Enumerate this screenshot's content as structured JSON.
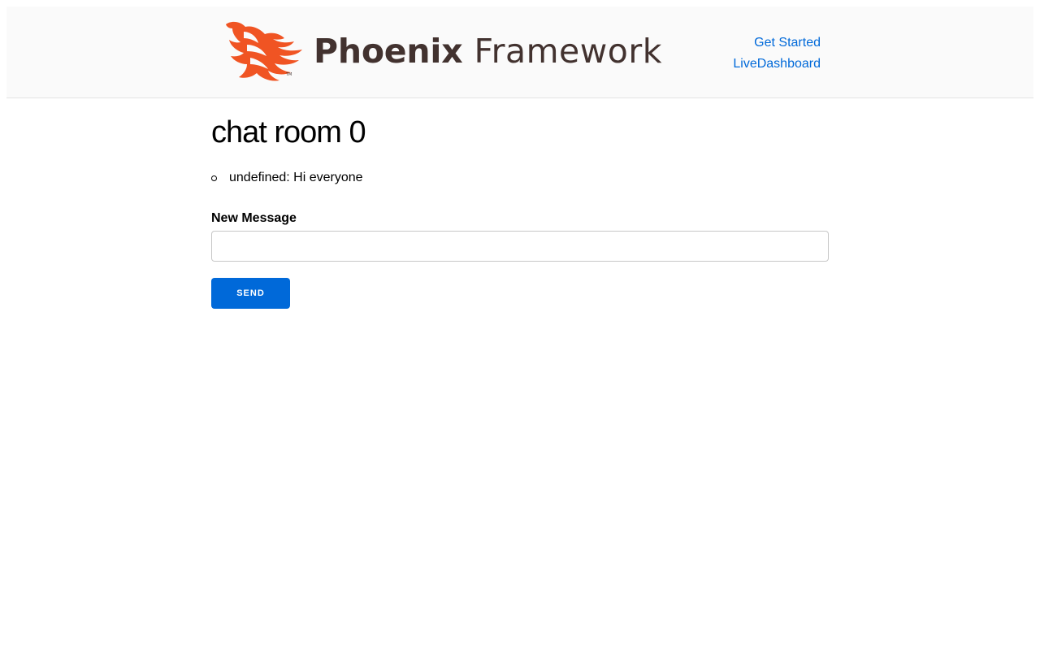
{
  "header": {
    "logo": {
      "icon": "phoenix-bird-icon",
      "brand_bold": "Phoenix",
      "brand_light": "Framework",
      "brand_color": "#42322f",
      "icon_color": "#f05423"
    },
    "nav": {
      "get_started": "Get Started",
      "live_dashboard": "LiveDashboard",
      "link_color": "#0069d9"
    }
  },
  "main": {
    "title": "chat room 0",
    "messages": [
      {
        "text": "undefined: Hi everyone"
      }
    ],
    "form": {
      "label": "New Message",
      "input_value": "",
      "send_label": "Send",
      "button_color": "#0069d9"
    }
  }
}
